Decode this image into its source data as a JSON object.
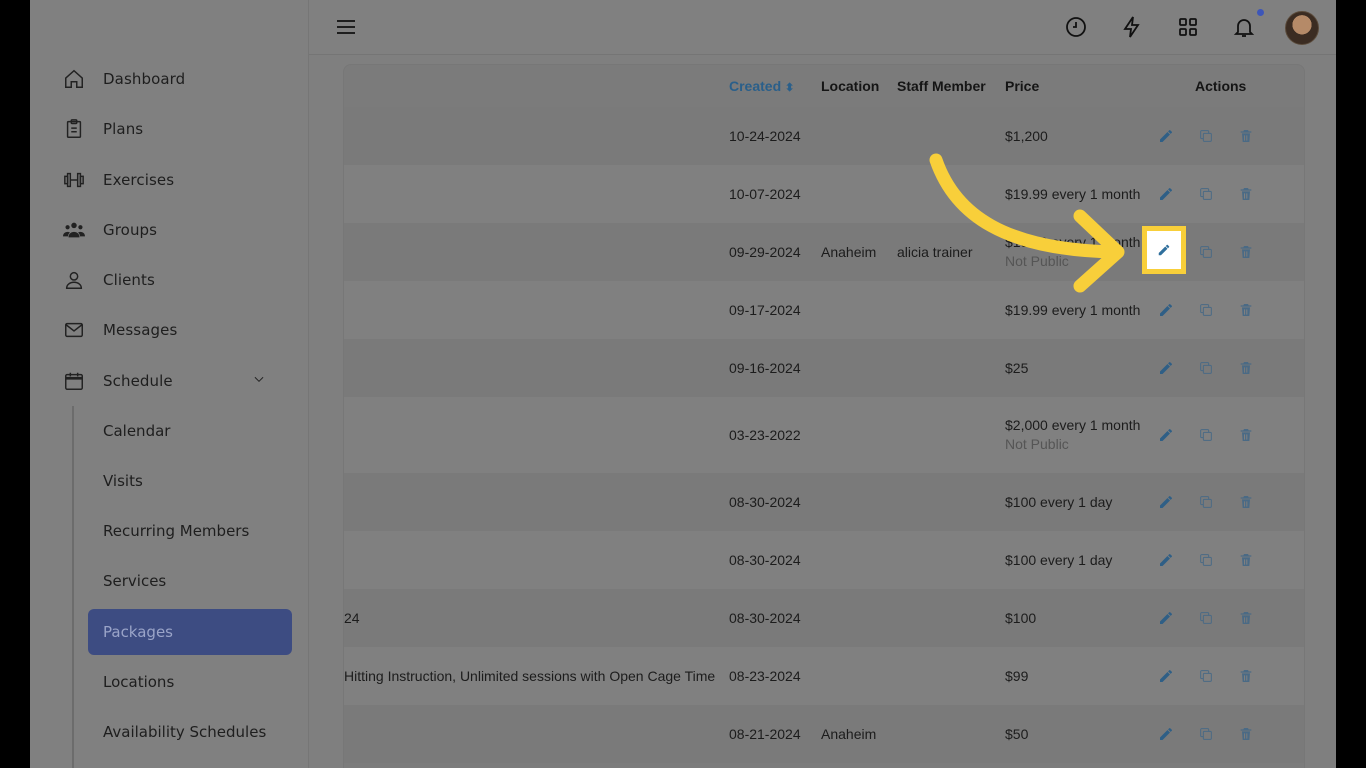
{
  "sidebar": {
    "items": [
      {
        "label": "Dashboard",
        "icon": "home-icon"
      },
      {
        "label": "Plans",
        "icon": "clipboard-icon"
      },
      {
        "label": "Exercises",
        "icon": "dumbbell-icon"
      },
      {
        "label": "Groups",
        "icon": "group-icon"
      },
      {
        "label": "Clients",
        "icon": "user-icon"
      },
      {
        "label": "Messages",
        "icon": "mail-icon"
      },
      {
        "label": "Schedule",
        "icon": "calendar-icon"
      }
    ],
    "schedule_sub": [
      {
        "label": "Calendar"
      },
      {
        "label": "Visits"
      },
      {
        "label": "Recurring Members"
      },
      {
        "label": "Services"
      },
      {
        "label": "Packages",
        "active": true
      },
      {
        "label": "Locations"
      },
      {
        "label": "Availability Schedules"
      }
    ]
  },
  "topbar": {
    "icons": [
      "menu-icon",
      "clock-icon",
      "lightning-icon",
      "grid-icon",
      "bell-icon"
    ],
    "notification_dot_color": "#3d56b8"
  },
  "table": {
    "headers": {
      "created": "Created",
      "location": "Location",
      "staff": "Staff Member",
      "price": "Price",
      "actions": "Actions"
    },
    "rows": [
      {
        "name": "",
        "created": "10-24-2024",
        "location": "",
        "staff": "",
        "price": "$1,200",
        "sub": ""
      },
      {
        "name": "",
        "created": "10-07-2024",
        "location": "",
        "staff": "",
        "price": "$19.99 every 1 month",
        "sub": ""
      },
      {
        "name": "",
        "created": "09-29-2024",
        "location": "Anaheim",
        "staff": "alicia trainer",
        "price": "$19.99 every 1 month",
        "sub": "Not Public"
      },
      {
        "name": "",
        "created": "09-17-2024",
        "location": "",
        "staff": "",
        "price": "$19.99 every 1 month",
        "sub": ""
      },
      {
        "name": "",
        "created": "09-16-2024",
        "location": "",
        "staff": "",
        "price": "$25",
        "sub": ""
      },
      {
        "name": "",
        "created": "03-23-2022",
        "location": "",
        "staff": "",
        "price": "$2,000 every 1 month",
        "sub": "Not Public"
      },
      {
        "name": "",
        "created": "08-30-2024",
        "location": "",
        "staff": "",
        "price": "$100 every 1 day",
        "sub": ""
      },
      {
        "name": "",
        "created": "08-30-2024",
        "location": "",
        "staff": "",
        "price": "$100 every 1 day",
        "sub": ""
      },
      {
        "name": "24",
        "created": "08-30-2024",
        "location": "",
        "staff": "",
        "price": "$100",
        "sub": ""
      },
      {
        "name": "Hitting Instruction, Unlimited sessions with Open Cage Time",
        "created": "08-23-2024",
        "location": "",
        "staff": "",
        "price": "$99",
        "sub": ""
      },
      {
        "name": "",
        "created": "08-21-2024",
        "location": "Anaheim",
        "staff": "",
        "price": "$50",
        "sub": ""
      }
    ]
  },
  "colors": {
    "accent": "#3d4c82",
    "highlight": "#f8cf3a",
    "link": "#2a5f8a"
  }
}
